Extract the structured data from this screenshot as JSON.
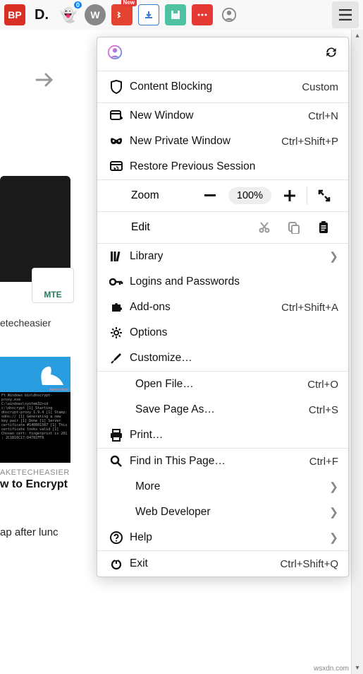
{
  "toolbar": {
    "ghost_badge": "0",
    "new_badge": "New"
  },
  "menu": {
    "content_blocking": {
      "label": "Content Blocking",
      "status": "Custom"
    },
    "new_window": {
      "label": "New Window",
      "shortcut": "Ctrl+N"
    },
    "new_private": {
      "label": "New Private Window",
      "shortcut": "Ctrl+Shift+P"
    },
    "restore_session": {
      "label": "Restore Previous Session"
    },
    "zoom": {
      "label": "Zoom",
      "level": "100%"
    },
    "edit": {
      "label": "Edit"
    },
    "library": {
      "label": "Library"
    },
    "logins": {
      "label": "Logins and Passwords"
    },
    "addons": {
      "label": "Add-ons",
      "shortcut": "Ctrl+Shift+A"
    },
    "options": {
      "label": "Options"
    },
    "customize": {
      "label": "Customize…"
    },
    "open_file": {
      "label": "Open File…",
      "shortcut": "Ctrl+O"
    },
    "save_as": {
      "label": "Save Page As…",
      "shortcut": "Ctrl+S"
    },
    "print": {
      "label": "Print…"
    },
    "find": {
      "label": "Find in This Page…",
      "shortcut": "Ctrl+F"
    },
    "more": {
      "label": "More"
    },
    "web_dev": {
      "label": "Web Developer"
    },
    "help": {
      "label": "Help"
    },
    "exit": {
      "label": "Exit",
      "shortcut": "Ctrl+Shift+Q"
    }
  },
  "behind": {
    "link1": "etecheasier",
    "mte": "MTE",
    "category": "AKETECHEASIER",
    "headline": "w to Encrypt",
    "snippet": "ap after lunc",
    "term_text": "Ft Windows bin\\dnscrypt-proxy.exe\nC:\\windows\\system32>cd c:\\dnscrypt\n[1] Starting dnscrypt-proxy 1.9.4\n[1] Stamp: sdns://\n[1] Generating a new key pair\n[1] Done\n[1] Server certificate #140001567\n[1] This certificate looks valid\n[1] Chosen cert: fingerprint is 201\n: 2C1B16C17:D4781FF8"
  },
  "watermark": "wsxdn.com"
}
